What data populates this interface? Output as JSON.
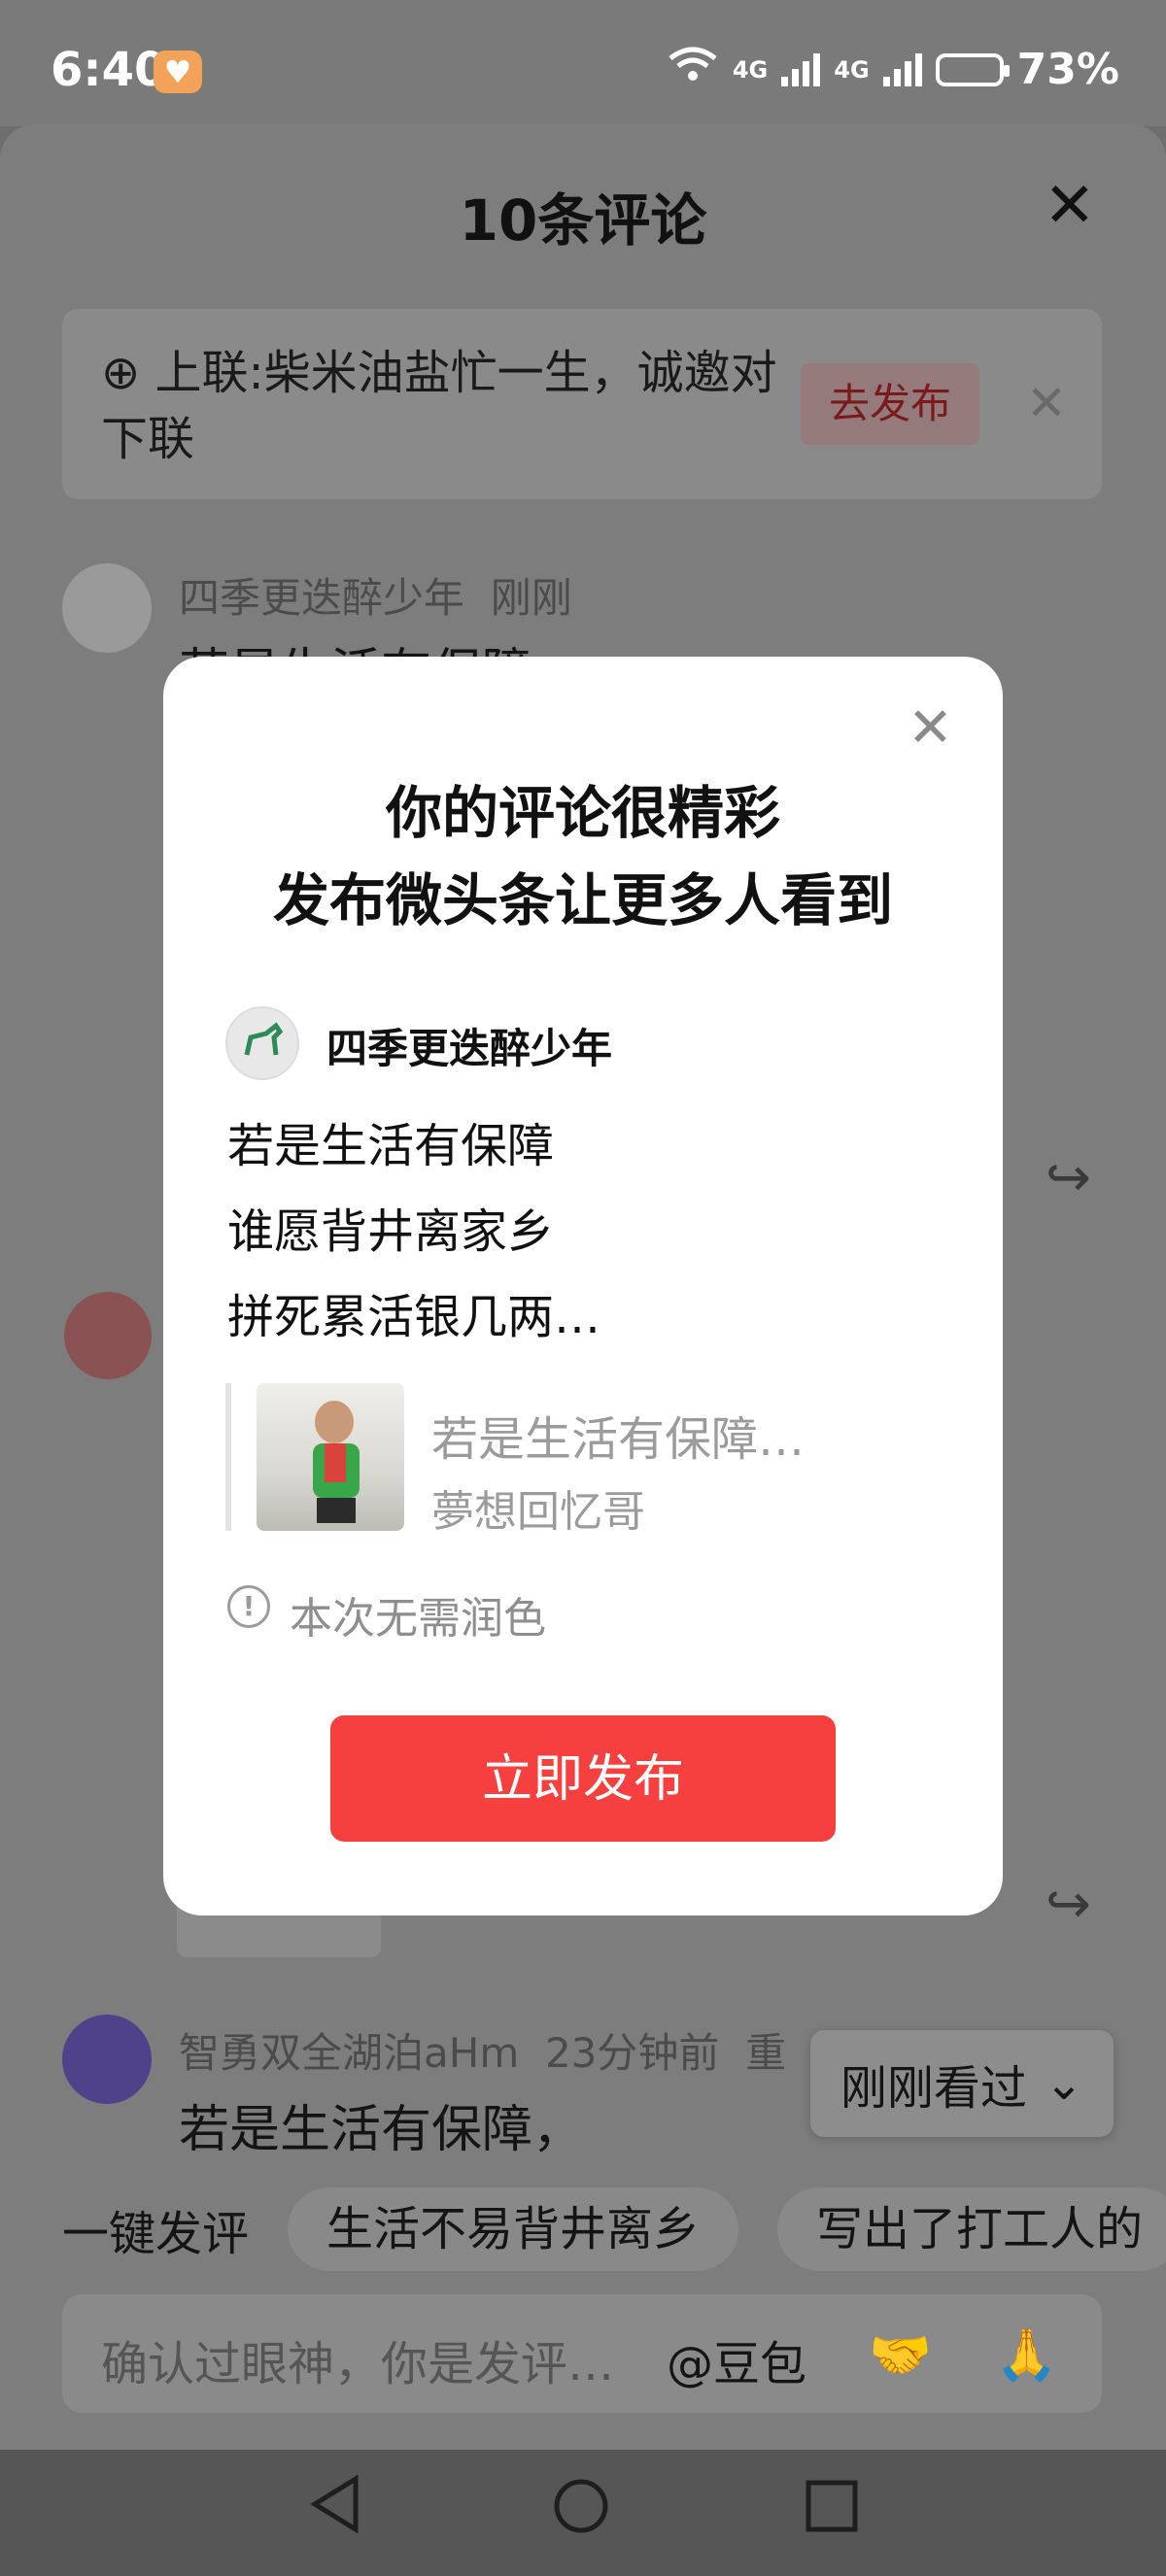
{
  "status_bar": {
    "time": "6:40",
    "network_1": "4G",
    "network_2": "4G",
    "battery": "73%"
  },
  "sheet": {
    "title": "10条评论",
    "topic": {
      "text": "上联:柴米油盐忙一生，诚邀对下联",
      "button": "去发布"
    },
    "comments": [
      {
        "user": "四季更迭醉少年",
        "time": "刚刚",
        "text": "若是生活有保障"
      },
      {
        "user": "",
        "time": "",
        "text": ""
      },
      {
        "user": "智勇双全湖泊aHm",
        "time": "23分钟前",
        "extra": "重",
        "text": "若是生活有保障，"
      }
    ],
    "recent_button": "刚刚看过",
    "quick_reply": {
      "label": "一键发评",
      "chips": [
        "生活不易背井离乡",
        "写出了打工人的"
      ]
    },
    "input": {
      "placeholder": "确认过眼神，你是发评…",
      "mention": "@豆包"
    }
  },
  "modal": {
    "title_line1": "你的评论很精彩",
    "title_line2": "发布微头条让更多人看到",
    "user": "四季更迭醉少年",
    "lines": [
      "若是生活有保障",
      "谁愿背井离家乡",
      "拼死累活银几两…"
    ],
    "quote": {
      "title": "若是生活有保障…",
      "author": "夢想回忆哥"
    },
    "notice": "本次无需润色",
    "publish_button": "立即发布"
  },
  "colors": {
    "accent_red": "#f5403f",
    "overlay": "#7d7d7d"
  },
  "icons": [
    "wifi-icon",
    "signal-icon",
    "battery-icon",
    "close-icon",
    "topic-hash-icon",
    "share-icon",
    "chevron-down-icon",
    "info-icon",
    "handshake-emoji",
    "pray-emoji",
    "back-icon",
    "home-icon",
    "recents-icon"
  ]
}
